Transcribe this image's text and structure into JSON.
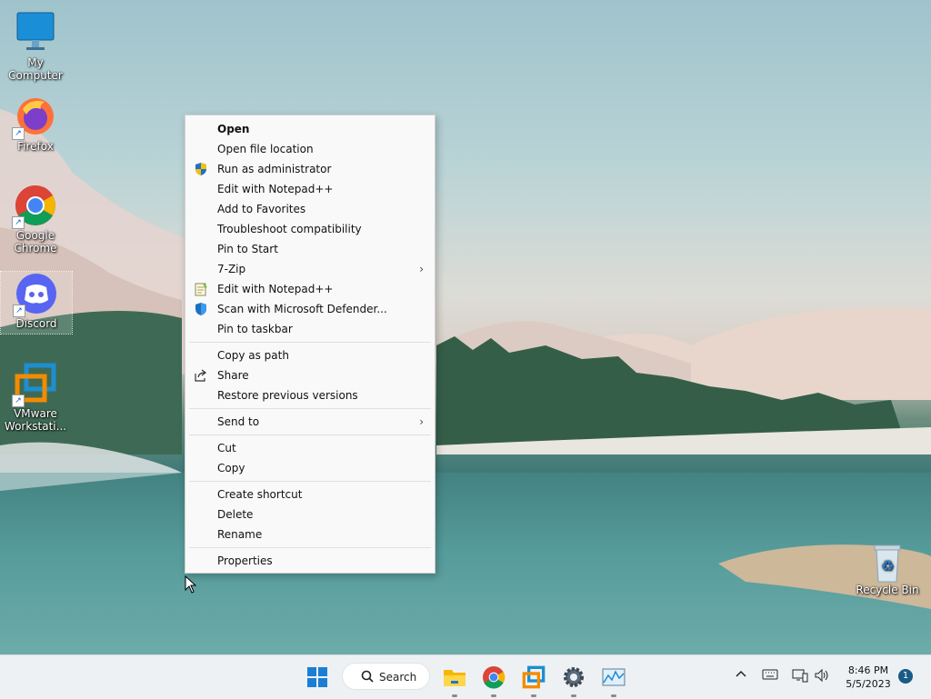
{
  "desktop": {
    "icons": [
      {
        "label": "My Computer",
        "icon": "monitor-icon"
      },
      {
        "label": "Firefox",
        "icon": "firefox-icon"
      },
      {
        "label": "Google Chrome",
        "icon": "chrome-icon"
      },
      {
        "label": "Discord",
        "icon": "discord-icon"
      },
      {
        "label": "VMware Workstati...",
        "icon": "vmware-icon"
      }
    ],
    "recycle_bin": {
      "label": "Recycle Bin",
      "icon": "recycle-bin-icon"
    }
  },
  "context_menu": {
    "items": [
      {
        "label": "Open",
        "icon": ""
      },
      {
        "label": "Open file location",
        "icon": ""
      },
      {
        "label": "Run as administrator",
        "icon": "uac-shield-icon"
      },
      {
        "label": "Edit with Notepad++",
        "icon": ""
      },
      {
        "label": "Add to Favorites",
        "icon": ""
      },
      {
        "label": "Troubleshoot compatibility",
        "icon": ""
      },
      {
        "label": "Pin to Start",
        "icon": ""
      },
      {
        "label": "7-Zip",
        "icon": "",
        "submenu": "›"
      },
      {
        "label": "Edit with Notepad++",
        "icon": "notepadpp-icon"
      },
      {
        "label": "Scan with Microsoft Defender...",
        "icon": "defender-shield-icon"
      },
      {
        "label": "Pin to taskbar",
        "icon": ""
      },
      {
        "label": "Copy as path",
        "icon": ""
      },
      {
        "label": "Share",
        "icon": "share-icon"
      },
      {
        "label": "Restore previous versions",
        "icon": ""
      },
      {
        "label": "Send to",
        "icon": "",
        "submenu": "›"
      },
      {
        "label": "Cut",
        "icon": ""
      },
      {
        "label": "Copy",
        "icon": ""
      },
      {
        "label": "Create shortcut",
        "icon": ""
      },
      {
        "label": "Delete",
        "icon": ""
      },
      {
        "label": "Rename",
        "icon": ""
      },
      {
        "label": "Properties",
        "icon": ""
      }
    ]
  },
  "taskbar": {
    "search_label": "Search",
    "apps": [
      "start-icon",
      "file-explorer-icon",
      "chrome-icon",
      "vmware-icon",
      "settings-icon",
      "resource-monitor-icon"
    ],
    "tray": {
      "chevron": "^",
      "clock_time": "8:46 PM",
      "clock_date": "5/5/2023",
      "notification_count": "1"
    }
  },
  "colors": {
    "menu_bg": "#f9f9f9",
    "taskbar_bg": "#eef1f4",
    "accent": "#1a5a88"
  }
}
